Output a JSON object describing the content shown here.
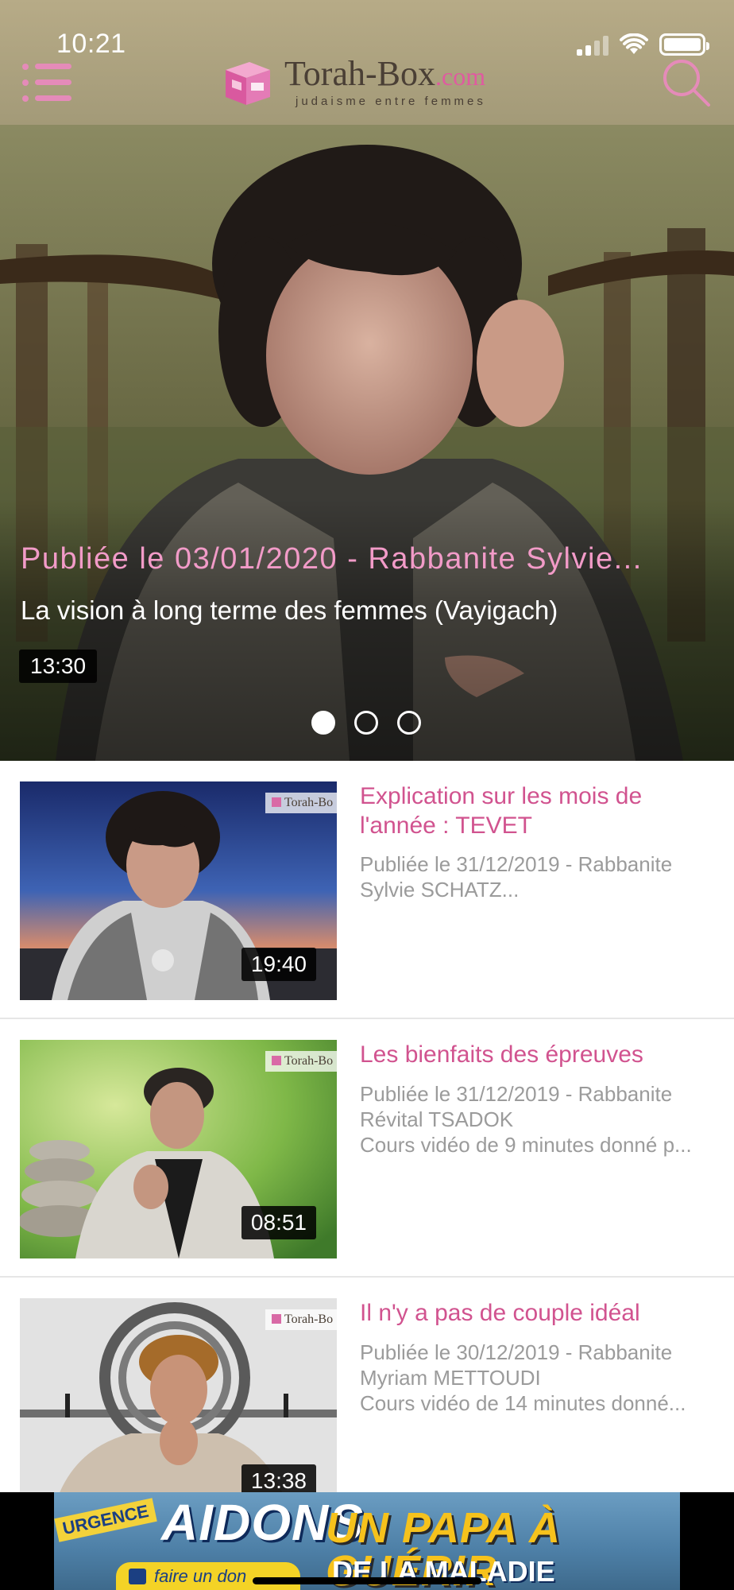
{
  "status_bar": {
    "time": "10:21"
  },
  "header": {
    "logo_name": "Torah-Box",
    "logo_domain": ".com",
    "logo_tagline": "judaisme entre femmes"
  },
  "hero": {
    "meta": "Publiée le 03/01/2020 - Rabbanite Sylvie...",
    "title": "La vision à long terme des femmes (Vayigach)",
    "duration": "13:30",
    "pager": {
      "count": 3,
      "active_index": 0
    }
  },
  "videos": [
    {
      "title_lines": [
        "Explication sur les mois de",
        "l'année : TEVET"
      ],
      "meta_lines": [
        "Publiée le 31/12/2019 - Rabbanite",
        "Sylvie SCHATZ..."
      ],
      "duration": "19:40",
      "thumb_badge": "Torah-Bo"
    },
    {
      "title_lines": [
        "Les bienfaits des épreuves"
      ],
      "meta_lines": [
        "Publiée le 31/12/2019 - Rabbanite",
        "Révital TSADOK",
        "Cours vidéo de 9 minutes donné p..."
      ],
      "duration": "08:51",
      "thumb_badge": "Torah-Bo"
    },
    {
      "title_lines": [
        "Il n'y a pas de couple idéal"
      ],
      "meta_lines": [
        "Publiée le 30/12/2019 - Rabbanite",
        "Myriam METTOUDI",
        "Cours vidéo de 14 minutes donné..."
      ],
      "duration": "13:38",
      "thumb_badge": "Torah-Bo"
    }
  ],
  "banner": {
    "urgence": "URGENCE",
    "headline": "AIDONS",
    "headline2": "UN PAPA À GUÉRIR",
    "headline3": "DE LA MALADIE",
    "cta": "faire un don"
  },
  "icons": {
    "menu": "menu-icon",
    "search": "search-icon",
    "logo": "torah-box-logo-icon"
  },
  "colors": {
    "accent_pink": "#d1538f",
    "hero_meta_pink": "#f29bc8",
    "header_bg": "#b0a581",
    "meta_gray": "#9b9b9b"
  }
}
